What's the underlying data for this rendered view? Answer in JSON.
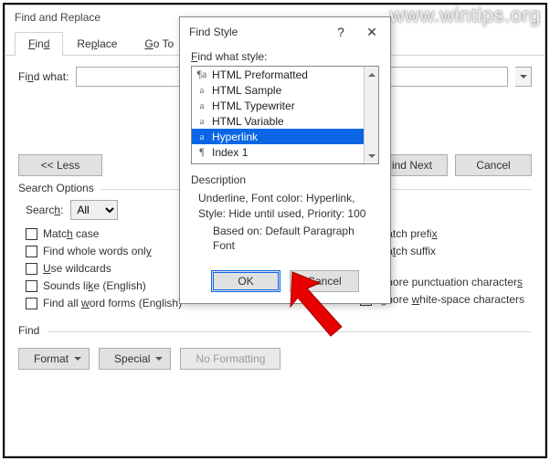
{
  "watermark": "www.wintips.org",
  "main": {
    "title": "Find and Replace",
    "tabs": {
      "find": "Find",
      "replace": "Replace",
      "goto": "Go To"
    },
    "find_what_label": "Find what:",
    "find_what_value": "",
    "btn_less": "<< Less",
    "btn_find_next": "Find Next",
    "btn_cancel": "Cancel"
  },
  "options": {
    "section_label": "Search Options",
    "search_label": "Search:",
    "search_value": "All",
    "match_case": "Match case",
    "whole_words": "Find whole words only",
    "wildcards": "Use wildcards",
    "sounds_like": "Sounds like (English)",
    "word_forms": "Find all word forms (English)",
    "match_prefix": "Match prefix",
    "match_suffix": "Match suffix",
    "ignore_punct": "Ignore punctuation characters",
    "ignore_ws": "Ignore white-space characters"
  },
  "find_section": {
    "label": "Find",
    "format": "Format",
    "special": "Special",
    "no_formatting": "No Formatting"
  },
  "modal": {
    "title": "Find Style",
    "help": "?",
    "close": "✕",
    "list_label": "Find what style:",
    "items": [
      {
        "icon": "¶a",
        "label": "HTML Preformatted"
      },
      {
        "icon": "a",
        "label": "HTML Sample"
      },
      {
        "icon": "a",
        "label": "HTML Typewriter"
      },
      {
        "icon": "a",
        "label": "HTML Variable"
      },
      {
        "icon": "a",
        "label": "Hyperlink",
        "selected": true
      },
      {
        "icon": "¶",
        "label": "Index 1"
      }
    ],
    "desc_label": "Description",
    "desc_line1": "Underline, Font color: Hyperlink, Style: Hide until used, Priority: 100",
    "desc_line2": "Based on: Default Paragraph Font",
    "ok": "OK",
    "cancel": "Cancel"
  }
}
